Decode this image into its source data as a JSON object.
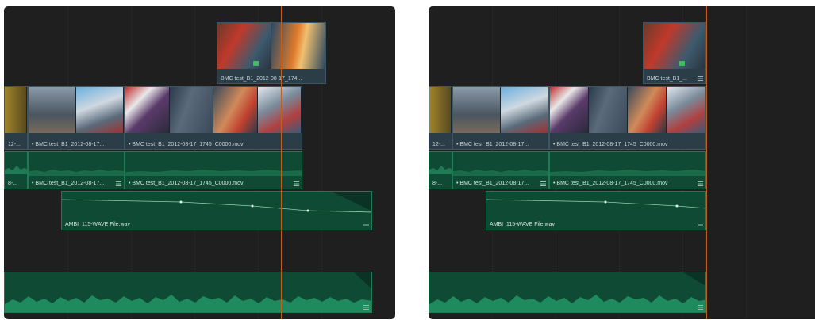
{
  "panels": [
    {
      "name": "timeline-before",
      "clips": {
        "v2": "BMC test_B1_2012-08-17_174...",
        "v1a_fragment": "12-...",
        "v1b": "• BMC test_B1_2012-08-17...",
        "v1c": "• BMC test_B1_2012-08-17_1745_C0000.mov",
        "a1a_fragment": "8-...",
        "a1b": "• BMC test_B1_2012-08-17...",
        "a1c": "• BMC test_B1_2012-08-17_1745_C0000.mov",
        "a2": "AMBI_115-WAVE File.wav"
      }
    },
    {
      "name": "timeline-after",
      "clips": {
        "v2": "BMC test_B1_...",
        "v1a_fragment": "12-...",
        "v1b": "• BMC test_B1_2012-08-17...",
        "v1c": "• BMC test_B1_2012-08-17_1745_C0000.mov",
        "a1a_fragment": "8-...",
        "a1b": "• BMC test_B1_2012-08-17...",
        "a1c": "• BMC test_B1_2012-08-17_1745_C0000.mov",
        "a2": "AMBI_115-WAVE File.wav"
      }
    }
  ],
  "colors": {
    "playhead": "#c45e1c",
    "audio_clip": "#0f4a34",
    "video_clip": "#2b3d47",
    "panel_bg": "#1f1f1f"
  }
}
